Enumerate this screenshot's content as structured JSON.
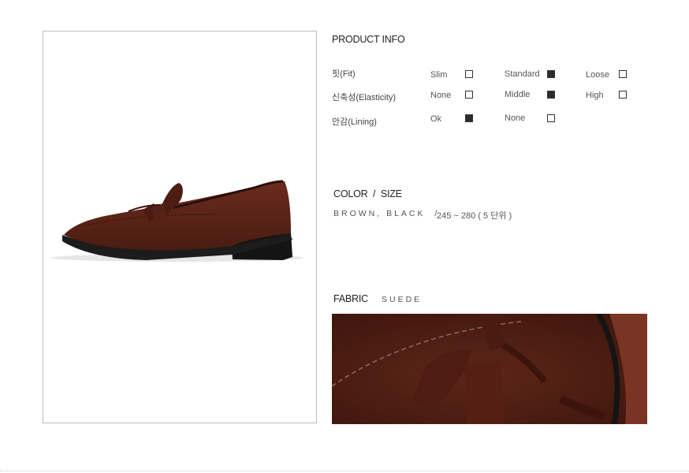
{
  "product_info": {
    "title": "PRODUCT INFO",
    "rows": [
      {
        "label": "핏(Fit)",
        "options": [
          {
            "name": "Slim",
            "checked": false
          },
          {
            "name": "Standard",
            "checked": true
          },
          {
            "name": "Loose",
            "checked": false
          }
        ]
      },
      {
        "label": "신축성(Elasticity)",
        "options": [
          {
            "name": "None",
            "checked": false
          },
          {
            "name": "Middle",
            "checked": true
          },
          {
            "name": "High",
            "checked": false
          }
        ]
      },
      {
        "label": "안감(Lining)",
        "options": [
          {
            "name": "Ok",
            "checked": true
          },
          {
            "name": "None",
            "checked": false
          }
        ]
      }
    ]
  },
  "color_size": {
    "title": "COLOR  /  SIZE",
    "colors": "BROWN, BLACK  /",
    "size_range": "245 ~ 280 ( 5 단위 )"
  },
  "fabric": {
    "title": "FABRIC",
    "value": "SUEDE"
  },
  "colors": {
    "suede": "#5a2418",
    "sole": "#1c1c1c",
    "frame_border": "#bdbdbd"
  }
}
